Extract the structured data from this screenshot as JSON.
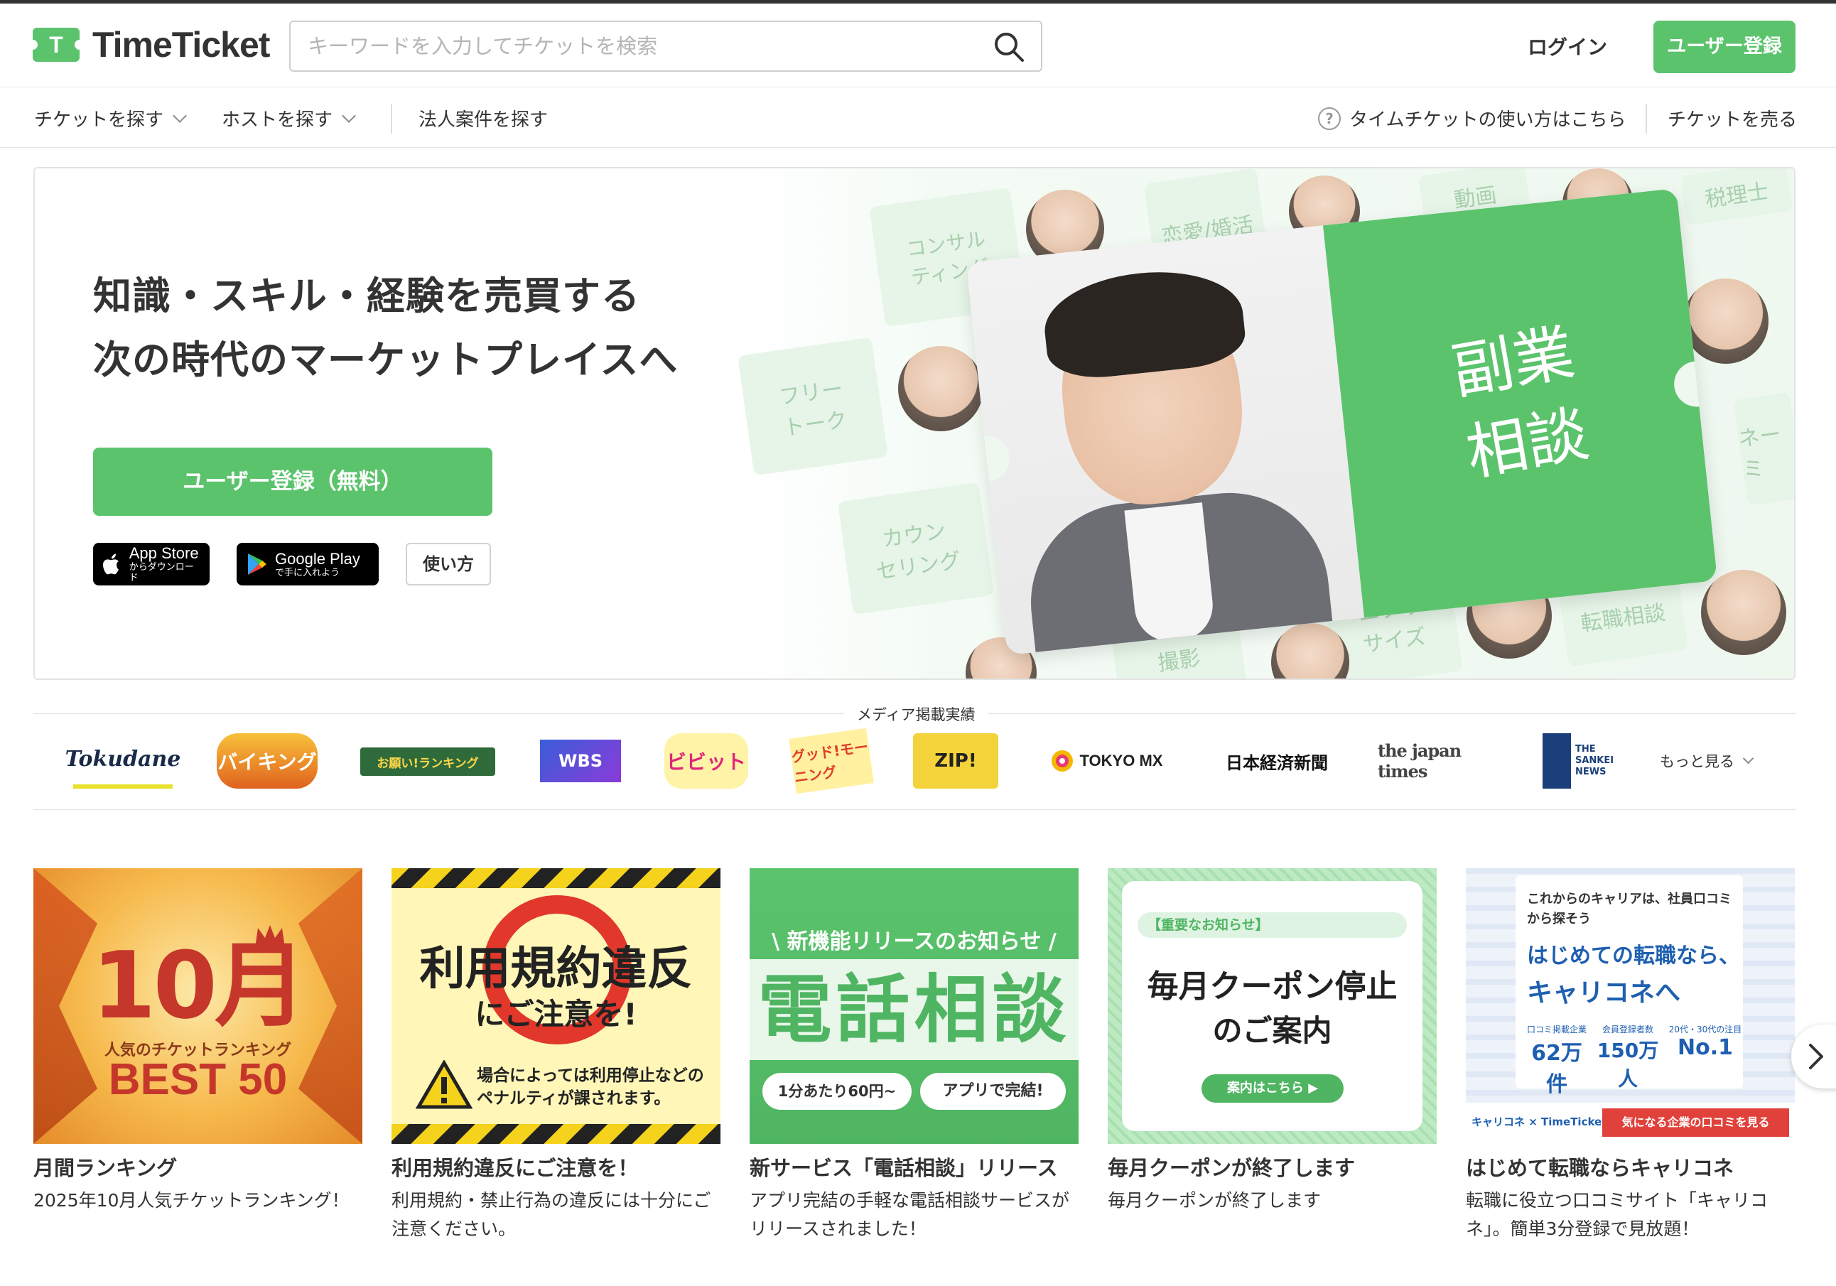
{
  "header": {
    "logo_text": "TimeTicket",
    "logo_mark": "T",
    "search_placeholder": "キーワードを入力してチケットを検索",
    "login": "ログイン",
    "register": "ユーザー登録"
  },
  "subnav": {
    "find_ticket": "チケットを探す",
    "find_host": "ホストを探す",
    "corporate": "法人案件を探す",
    "howto": "タイムチケットの使い方はこちら",
    "sell": "チケットを売る"
  },
  "hero": {
    "title_line1": "知識・スキル・経験を売買する",
    "title_line2": "次の時代のマーケットプレイスへ",
    "cta": "ユーザー登録（無料）",
    "appstore_big": "App Store",
    "appstore_small": "からダウンロード",
    "googleplay_big": "Google Play",
    "googleplay_small": "で手に入れよう",
    "howto": "使い方",
    "ticket_text": "副業\n相談",
    "mini_tickets": [
      "コンサル\nティング",
      "恋愛/婚活",
      "動画\n制作",
      "税理士",
      "フリー\nトーク",
      "カウン\nセリング",
      "エクサ\nサイズ",
      "転職相談",
      "ネーミ",
      "撮影"
    ]
  },
  "media": {
    "label": "メディア掲載実績",
    "logos": [
      "Tokudane",
      "バイキング",
      "お願い!ランキング",
      "WBS",
      "ビビット",
      "グッド!モーニング",
      "ZIP!",
      "TOKYO MX",
      "日本経済新聞",
      "the japan times",
      "THE SANKEI NEWS"
    ],
    "more": "もっと見る"
  },
  "cards": [
    {
      "img_big": "10月",
      "img_sub": "人気のチケットランキング",
      "img_best": "BEST 50",
      "title": "月間ランキング",
      "desc": "2025年10月人気チケットランキング！"
    },
    {
      "img_line1": "利用規約違反",
      "img_line2": "にご注意を!",
      "img_note": "場合によっては利用停止などの\nペナルティが課されます。",
      "title": "利用規約違反にご注意を！",
      "desc": "利用規約・禁止行為の違反には十分にご注意ください。"
    },
    {
      "img_top": "新機能リリースのお知らせ",
      "img_main": "電話相談",
      "img_pill1": "1分あたり60円~",
      "img_pill2": "アプリで完結!",
      "title": "新サービス「電話相談」リリース",
      "desc": "アプリ完結の手軽な電話相談サービスがリリースされました！"
    },
    {
      "img_tag": "【重要なお知らせ】",
      "img_main1": "毎月クーポン停止",
      "img_main2": "のご案内",
      "img_btn": "案内はこちら",
      "title": "毎月クーポンが終了します",
      "desc": "毎月クーポンが終了します"
    },
    {
      "img_lead": "これからのキャリアは、社員口コミから探そう",
      "img_main1": "はじめての転職なら、",
      "img_main2": "キャリコネへ",
      "badge1": "62万件",
      "badge2": "150万人",
      "badge3": "No.1",
      "badge1_label": "口コミ掲載企業",
      "badge2_label": "会員登録者数",
      "badge3_label": "20代・30代の注目",
      "img_brand": "キャリコネ × TimeTicket",
      "img_cta": "気になる企業の口コミを見る",
      "title": "はじめて転職ならキャリコネ",
      "desc": "転職に役立つ口コミサイト「キャリコネ」。簡単3分登録で見放題！"
    }
  ],
  "colors": {
    "brand_green": "#5cc36d",
    "text": "#333333"
  }
}
